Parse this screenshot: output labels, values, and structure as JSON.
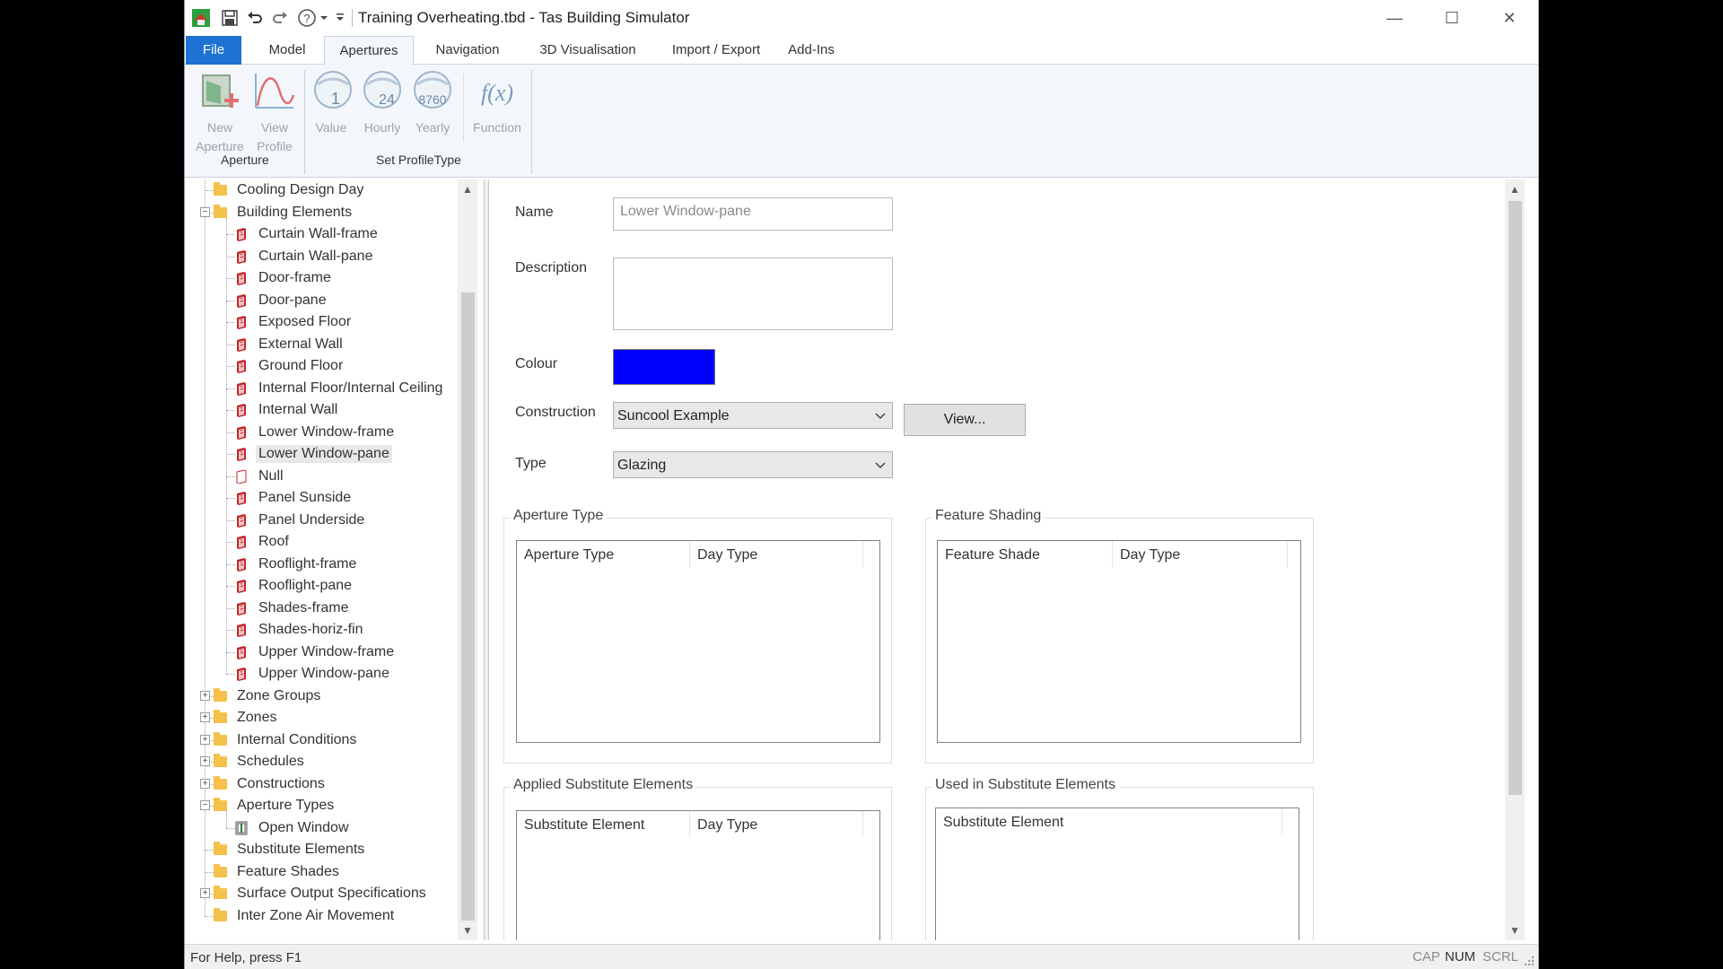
{
  "window": {
    "title": "Training Overheating.tbd - Tas Building Simulator",
    "minimize_label": "—",
    "maximize_label": "☐",
    "close_label": "✕"
  },
  "ribbon": {
    "tabs": [
      "File",
      "Model",
      "Apertures",
      "Navigation",
      "3D Visualisation",
      "Import / Export",
      "Add-Ins"
    ],
    "active_tab": "Apertures",
    "groups": {
      "aperture": {
        "label": "Aperture",
        "new_aperture": [
          "New",
          "Aperture"
        ],
        "view_profile": [
          "View",
          "Profile"
        ]
      },
      "set_profile_type": {
        "label": "Set ProfileType",
        "value": "Value",
        "hourly": "Hourly",
        "yearly": "Yearly",
        "function": "Function"
      }
    },
    "icon_text": {
      "value": "1",
      "hourly": "24",
      "yearly": "8760",
      "function": "f(x)"
    }
  },
  "tree": {
    "nodes": [
      {
        "label": "Cooling Design Day",
        "level": 0,
        "kind": "folder",
        "expander": ""
      },
      {
        "label": "Building Elements",
        "level": 0,
        "kind": "folder",
        "expander": "−"
      },
      {
        "label": "Curtain Wall-frame",
        "level": 1,
        "kind": "element"
      },
      {
        "label": "Curtain Wall-pane",
        "level": 1,
        "kind": "element"
      },
      {
        "label": "Door-frame",
        "level": 1,
        "kind": "element"
      },
      {
        "label": "Door-pane",
        "level": 1,
        "kind": "element"
      },
      {
        "label": "Exposed Floor",
        "level": 1,
        "kind": "element"
      },
      {
        "label": "External Wall",
        "level": 1,
        "kind": "element"
      },
      {
        "label": "Ground Floor",
        "level": 1,
        "kind": "element"
      },
      {
        "label": "Internal Floor/Internal Ceiling",
        "level": 1,
        "kind": "element"
      },
      {
        "label": "Internal Wall",
        "level": 1,
        "kind": "element"
      },
      {
        "label": "Lower Window-frame",
        "level": 1,
        "kind": "element"
      },
      {
        "label": "Lower Window-pane",
        "level": 1,
        "kind": "element",
        "selected": true
      },
      {
        "label": "Null",
        "level": 1,
        "kind": "null-element"
      },
      {
        "label": "Panel Sunside",
        "level": 1,
        "kind": "element"
      },
      {
        "label": "Panel Underside",
        "level": 1,
        "kind": "element"
      },
      {
        "label": "Roof",
        "level": 1,
        "kind": "element"
      },
      {
        "label": "Rooflight-frame",
        "level": 1,
        "kind": "element"
      },
      {
        "label": "Rooflight-pane",
        "level": 1,
        "kind": "element"
      },
      {
        "label": "Shades-frame",
        "level": 1,
        "kind": "element"
      },
      {
        "label": "Shades-horiz-fin",
        "level": 1,
        "kind": "element"
      },
      {
        "label": "Upper Window-frame",
        "level": 1,
        "kind": "element"
      },
      {
        "label": "Upper Window-pane",
        "level": 1,
        "kind": "element"
      },
      {
        "label": "Zone Groups",
        "level": 0,
        "kind": "folder",
        "expander": "+"
      },
      {
        "label": "Zones",
        "level": 0,
        "kind": "folder",
        "expander": "+"
      },
      {
        "label": "Internal Conditions",
        "level": 0,
        "kind": "folder",
        "expander": "+"
      },
      {
        "label": "Schedules",
        "level": 0,
        "kind": "folder",
        "expander": "+"
      },
      {
        "label": "Constructions",
        "level": 0,
        "kind": "folder",
        "expander": "+"
      },
      {
        "label": "Aperture Types",
        "level": 0,
        "kind": "folder",
        "expander": "−"
      },
      {
        "label": "Open Window",
        "level": 1,
        "kind": "aperture"
      },
      {
        "label": "Substitute Elements",
        "level": 0,
        "kind": "folder",
        "expander": ""
      },
      {
        "label": "Feature Shades",
        "level": 0,
        "kind": "folder",
        "expander": ""
      },
      {
        "label": "Surface Output Specifications",
        "level": 0,
        "kind": "folder",
        "expander": "+"
      },
      {
        "label": "Inter Zone Air Movement",
        "level": 0,
        "kind": "folder",
        "expander": ""
      }
    ],
    "scroll_up": "▲",
    "scroll_down": "▼"
  },
  "form": {
    "name_label": "Name",
    "name_value": "Lower Window-pane",
    "description_label": "Description",
    "description_value": "",
    "colour_label": "Colour",
    "colour_value": "#0000ff",
    "construction_label": "Construction",
    "construction_value": "Suncool Example",
    "view_button": "View...",
    "type_label": "Type",
    "type_value": "Glazing"
  },
  "groups": {
    "aperture_type": {
      "title": "Aperture Type",
      "columns": [
        "Aperture Type",
        "Day Type"
      ]
    },
    "feature_shading": {
      "title": "Feature Shading",
      "columns": [
        "Feature Shade",
        "Day Type"
      ]
    },
    "applied_substitute": {
      "title": "Applied Substitute Elements",
      "columns": [
        "Substitute Element",
        "Day Type"
      ]
    },
    "used_in_substitute": {
      "title": "Used in Substitute Elements",
      "columns": [
        "Substitute Element"
      ]
    }
  },
  "status": {
    "help_text": "For Help, press F1",
    "cap": "CAP",
    "num": "NUM",
    "scrl": "SCRL"
  },
  "colors": {
    "file_tab": "#1e72d2",
    "app_icon": "#2e9e3e",
    "element_icon": "#c0272d"
  }
}
